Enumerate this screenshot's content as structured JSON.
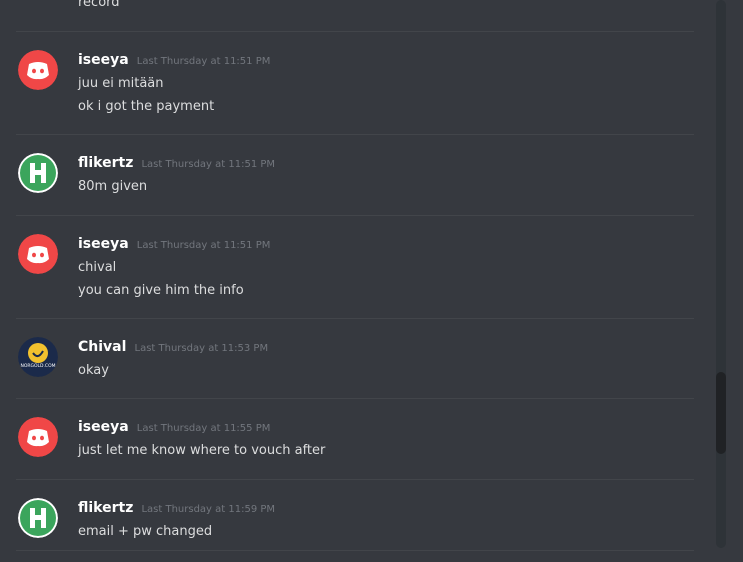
{
  "top_fragment": "record",
  "messages": [
    {
      "avatar": "discord-logo",
      "username": "iseeya",
      "timestamp": "Last Thursday at 11:51 PM",
      "lines": [
        "juu ei mitään",
        "ok i got the payment"
      ]
    },
    {
      "avatar": "green-h-logo",
      "username": "flikertz",
      "timestamp": "Last Thursday at 11:51 PM",
      "lines": [
        "80m given"
      ]
    },
    {
      "avatar": "discord-logo",
      "username": "iseeya",
      "timestamp": "Last Thursday at 11:51 PM",
      "lines": [
        "chival",
        "you can give him the info"
      ]
    },
    {
      "avatar": "norgold-logo",
      "username": "Chival",
      "timestamp": "Last Thursday at 11:53 PM",
      "lines": [
        "okay"
      ]
    },
    {
      "avatar": "discord-logo",
      "username": "iseeya",
      "timestamp": "Last Thursday at 11:55 PM",
      "lines": [
        "just let me know where to vouch after"
      ]
    },
    {
      "avatar": "green-h-logo",
      "username": "flikertz",
      "timestamp": "Last Thursday at 11:59 PM",
      "lines": [
        "email + pw changed"
      ]
    }
  ],
  "avatar_logo_text": "NORGOLD.COM",
  "colors": {
    "background": "#36393f",
    "discord_red": "#f04747",
    "green_avatar": "#3ba55c",
    "username": "#ffffff",
    "text": "#dcddde",
    "timestamp": "#72767d"
  }
}
